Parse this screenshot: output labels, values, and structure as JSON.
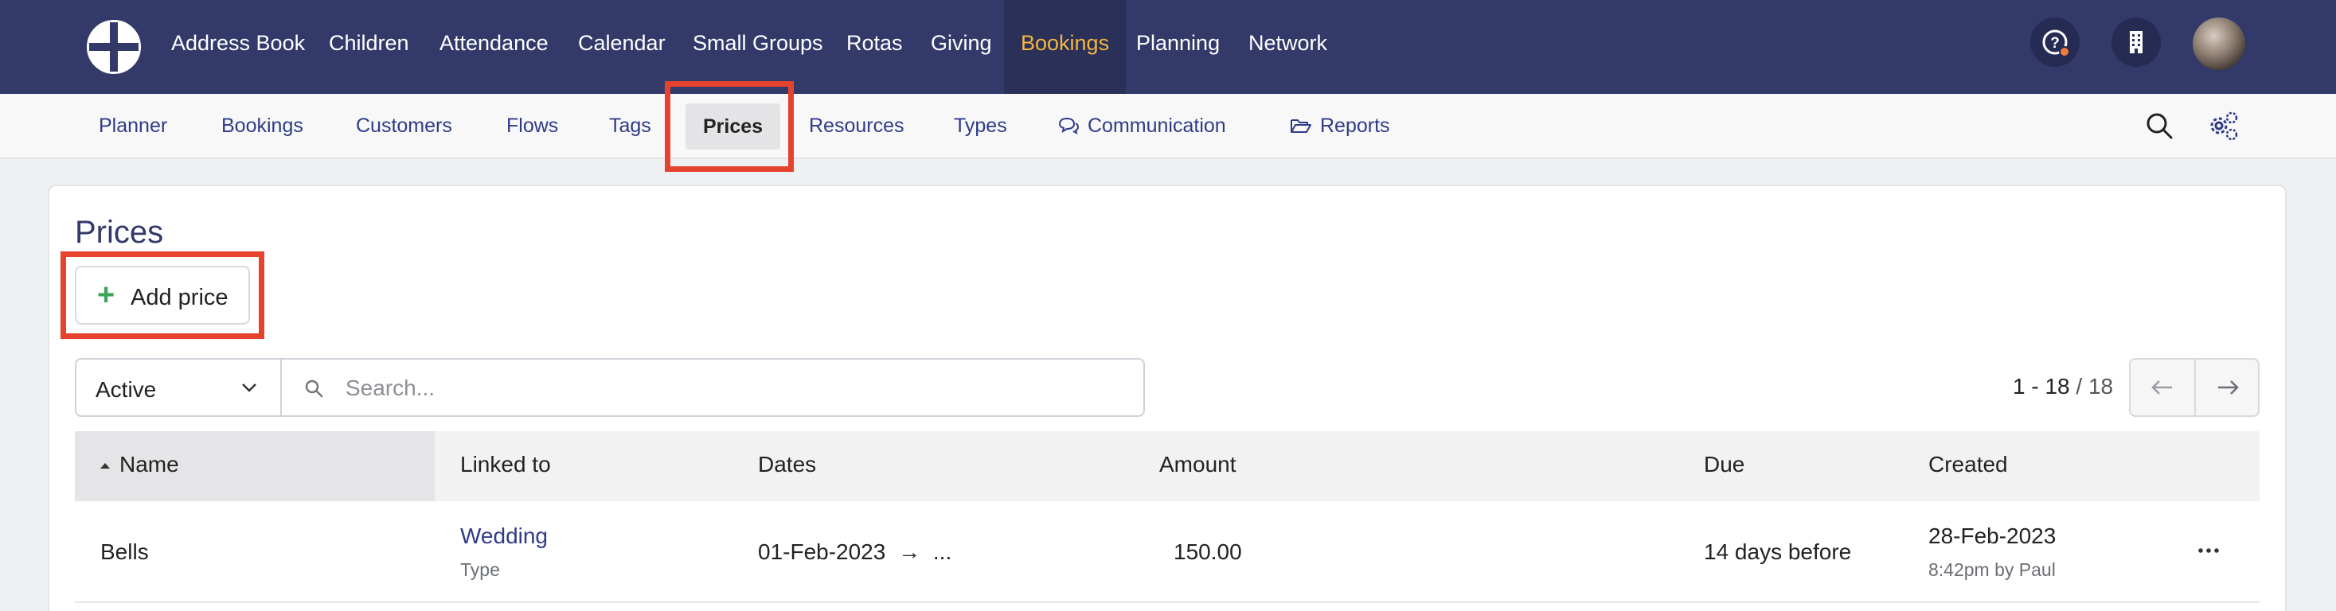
{
  "topnav": {
    "items": [
      "Address Book",
      "Children",
      "Attendance",
      "Calendar",
      "Small Groups",
      "Rotas",
      "Giving",
      "Bookings",
      "Planning",
      "Network"
    ],
    "active": "Bookings",
    "icons": [
      "help-icon",
      "building-icon"
    ]
  },
  "subnav": {
    "items": [
      "Planner",
      "Bookings",
      "Customers",
      "Flows",
      "Tags",
      "Prices",
      "Resources",
      "Types",
      "Communication",
      "Reports"
    ],
    "active": "Prices"
  },
  "page": {
    "title": "Prices",
    "add_button": "Add price"
  },
  "filter": {
    "status_value": "Active",
    "search_placeholder": "Search..."
  },
  "pagination": {
    "range": "1 - 18",
    "total": " / 18"
  },
  "table": {
    "columns": [
      "Name",
      "Linked to",
      "Dates",
      "Amount",
      "Due",
      "Created"
    ],
    "sorted_by": "Name",
    "rows": [
      {
        "name": "Bells",
        "linked_to": "Wedding",
        "linked_type": "Type",
        "date_start": "01-Feb-2023",
        "date_arrow": "→",
        "date_end": "...",
        "amount": "150.00",
        "due": "14 days before",
        "created_date": "28-Feb-2023",
        "created_meta": "8:42pm by Paul"
      }
    ]
  },
  "colors": {
    "topbar": "#333a6a",
    "accent_active": "#f4b63f",
    "link": "#2f3b86",
    "highlight": "#e5432d",
    "add_icon": "#3aa655"
  }
}
